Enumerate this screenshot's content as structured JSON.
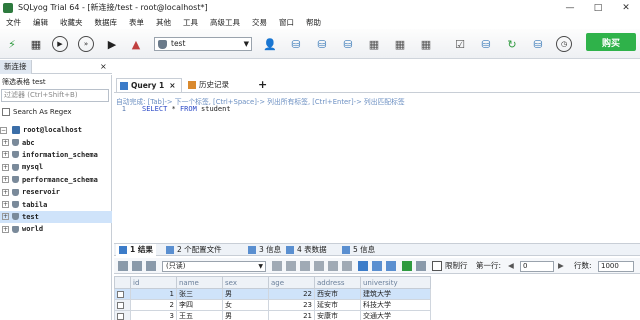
{
  "window": {
    "title": "SQLyog Trial 64 - [新连接/test - root@localhost*]",
    "controls": [
      "—",
      "□",
      "✕"
    ]
  },
  "menu": [
    "文件",
    "编辑",
    "收藏夹",
    "数据库",
    "表单",
    "其他",
    "工具",
    "高级工具",
    "交易",
    "窗口",
    "帮助"
  ],
  "toolbar": {
    "database_select": "test",
    "buy_button": "购买"
  },
  "connection_tab": {
    "label": "新连接",
    "close": "×"
  },
  "object_browser": {
    "filter_label": "筛选表格 test",
    "filter_placeholder": "过滤器 (Ctrl+Shift+B)",
    "search_label": "Search As Regex",
    "root": "root@localhost",
    "databases": [
      "abc",
      "information_schema",
      "mysql",
      "performance_schema",
      "reservoir",
      "tabila",
      "test",
      "world"
    ],
    "selected_database": "test"
  },
  "editor": {
    "tabs": [
      {
        "label": "Query 1",
        "close": "×"
      },
      {
        "label": "历史记录"
      }
    ],
    "add_tab": "+",
    "hint": "自动完成: [Tab]-> 下一个标签, [Ctrl+Space]-> 列出所有标签, [Ctrl+Enter]-> 列出匹配标签",
    "line_number": "1",
    "query_keyword1": "SELECT",
    "query_middle": " * ",
    "query_keyword2": "FROM",
    "query_rest": " student"
  },
  "results": {
    "tabs": [
      "1 结果",
      "2 个配置文件",
      "3 信息",
      "4 表数据",
      "5 信息"
    ],
    "view_select": "(只读)",
    "limit_label": "限制行",
    "first_row_label": "第一行:",
    "first_row_value": "0",
    "rows_label": "行数:",
    "rows_value": "1000",
    "columns": [
      "id",
      "name",
      "sex",
      "age",
      "address",
      "university"
    ],
    "rows": [
      [
        "1",
        "张三",
        "男",
        "22",
        "西安市",
        "建筑大学"
      ],
      [
        "2",
        "李四",
        "女",
        "23",
        "延安市",
        "科技大学"
      ],
      [
        "3",
        "王五",
        "男",
        "21",
        "安康市",
        "交通大学"
      ]
    ]
  },
  "colors": {
    "accent": "#3c7cc9",
    "buy_button": "#2fb24a",
    "selection": "#cfe3fa"
  }
}
